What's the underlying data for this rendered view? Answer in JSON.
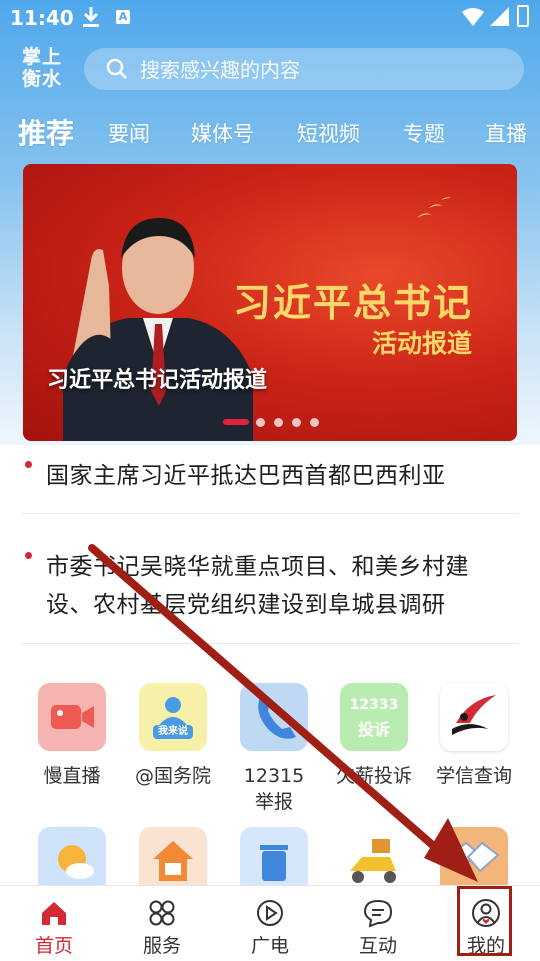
{
  "status_bar": {
    "time": "11:40",
    "download_icon": "download-icon",
    "a_icon_label": "A",
    "icons": [
      "wifi-icon",
      "signal-icon",
      "battery-icon"
    ]
  },
  "header": {
    "logo": "掌上衡水",
    "search_placeholder": "搜索感兴趣的内容"
  },
  "tabs": [
    {
      "label": "推荐",
      "active": true
    },
    {
      "label": "要闻"
    },
    {
      "label": "媒体号"
    },
    {
      "label": "短视频"
    },
    {
      "label": "专题"
    },
    {
      "label": "直播"
    }
  ],
  "banner": {
    "headline": "习近平总书记",
    "subhead": "活动报道",
    "caption": "习近平总书记活动报道",
    "slide_count": 5,
    "active_slide": 1
  },
  "news": [
    {
      "title": "国家主席习近平抵达巴西首都巴西利亚"
    },
    {
      "title_line1": "市委书记吴晓华就重点项目、和美乡村建",
      "title_line2": "设、农村基层党组织建设到阜城县调研"
    }
  ],
  "services": [
    {
      "label": "慢直播",
      "icon": "video-camera-icon",
      "color": "#f6b4b1"
    },
    {
      "label": "@国务院",
      "icon": "wo-lai-shuo-icon",
      "icon_text": "我来说",
      "color": "#f6f0a8"
    },
    {
      "label": "12315\n举报",
      "icon": "phone-icon",
      "color": "#bfd9f5"
    },
    {
      "label": "欠薪投诉",
      "icon": "complaint-icon",
      "icon_text_top": "12333",
      "icon_text_bottom": "投诉",
      "color": "#b8ecb0"
    },
    {
      "label": "学信查询",
      "icon": "xuexin-logo-icon",
      "color": "#ffffff"
    }
  ],
  "services_row2": [
    {
      "icon": "weather-icon",
      "color": "#cfe3fa"
    },
    {
      "icon": "housing-fund-icon",
      "color": "#fbe3d2"
    },
    {
      "icon": "trash-bin-icon",
      "color": "#d7e7fb"
    },
    {
      "icon": "delivery-scooter-icon",
      "color": "#ffffff"
    },
    {
      "icon": "handshake-icon",
      "color": "#f4b57a"
    }
  ],
  "bottom_nav": [
    {
      "label": "首页",
      "icon": "home-icon",
      "active": true
    },
    {
      "label": "服务",
      "icon": "grid-icon"
    },
    {
      "label": "广电",
      "icon": "play-circle-icon"
    },
    {
      "label": "互动",
      "icon": "chat-icon"
    },
    {
      "label": "我的",
      "icon": "profile-icon"
    }
  ],
  "colors": {
    "accent": "#d32a36",
    "header_blue": "#4fa8ec",
    "arrow": "#9f1f14",
    "banner_gold": "#ffd86a"
  }
}
